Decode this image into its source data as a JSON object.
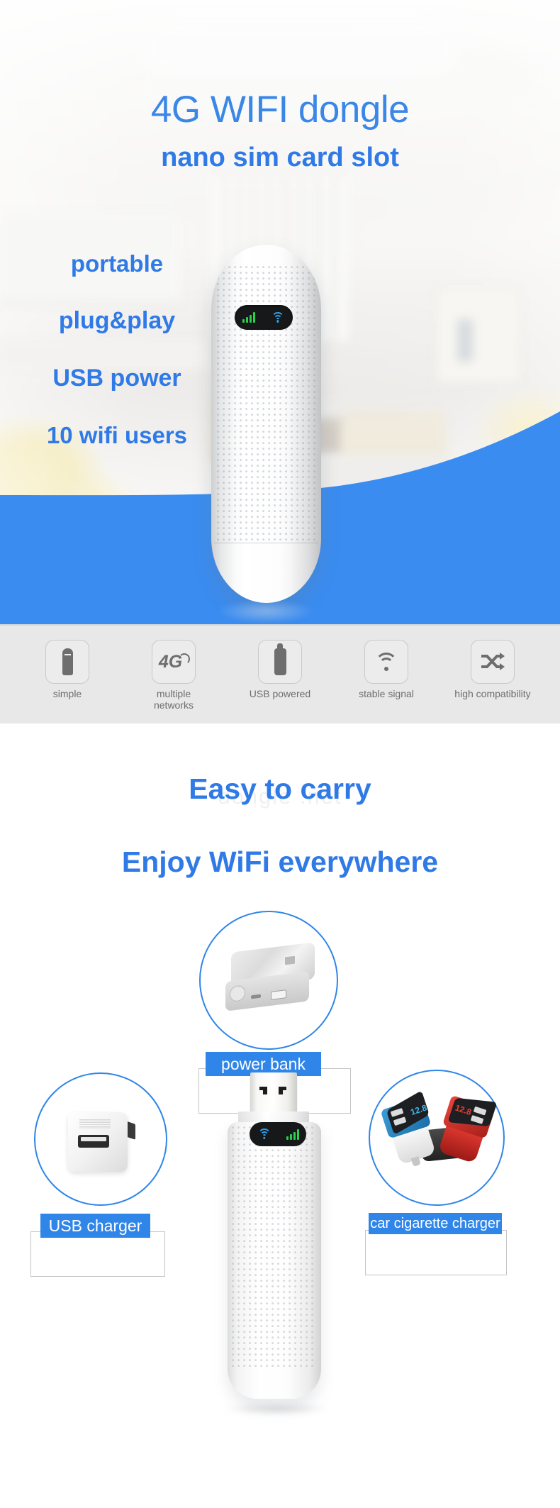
{
  "hero": {
    "title": "4G WIFI dongle",
    "subtitle": "nano sim card slot",
    "bullets": [
      "portable",
      "plug&play",
      "USB power",
      "10 wifi users"
    ],
    "led_icons": [
      "signal-bars-icon",
      "wifi-icon"
    ],
    "accent_blue": "#2f7ae6",
    "band_blue": "#3a8cf0"
  },
  "features": [
    {
      "icon": "usb-stick-icon",
      "label": "simple"
    },
    {
      "icon": "4g-signal-icon",
      "label": "multiple\nnetworks",
      "line1": "multiple",
      "line2": "networks"
    },
    {
      "icon": "usb-powered-icon",
      "label": "USB powered"
    },
    {
      "icon": "wifi-icon",
      "label": "stable signal"
    },
    {
      "icon": "shuffle-arrows-icon",
      "label": "high compatibility"
    }
  ],
  "middle": {
    "heading1": "Easy to carry",
    "heading2": "Enjoy WiFi everywhere",
    "watermark": "dongle .net"
  },
  "accessories": [
    {
      "name": "power-bank",
      "label": "power bank"
    },
    {
      "name": "usb-charger",
      "label": "USB charger"
    },
    {
      "name": "car-cigarette-charger",
      "label": "car cigarette charger"
    }
  ],
  "bottom_device": {
    "name": "usb-dongle",
    "led_icons": [
      "wifi-icon",
      "signal-bars-icon"
    ]
  },
  "colors": {
    "blue": "#2f85e8",
    "label_text": "#ffffff",
    "strip_bg": "#e8e8e8",
    "icon_gray": "#6e6e6e"
  }
}
